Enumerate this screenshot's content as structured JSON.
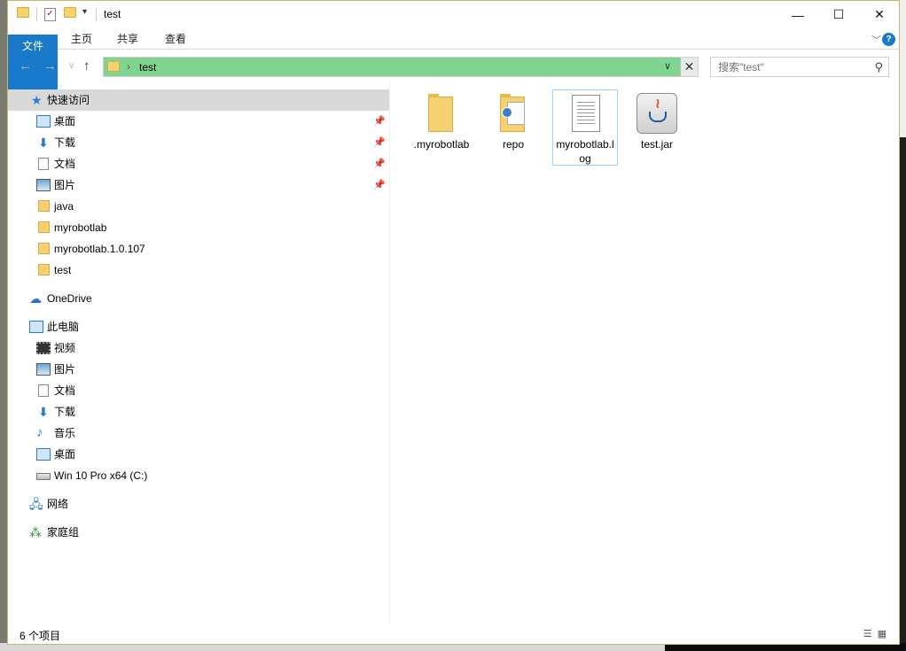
{
  "window": {
    "title": "test",
    "controls": {
      "minimize": "—",
      "maximize": "☐",
      "close": "✕"
    }
  },
  "ribbon": {
    "tabs": [
      {
        "label": "文件"
      },
      {
        "label": "主页"
      },
      {
        "label": "共享"
      },
      {
        "label": "查看"
      }
    ],
    "expand": "﹀",
    "help": "?"
  },
  "nav": {
    "back": "←",
    "forward": "→",
    "recent": "∨",
    "up": "↑",
    "crumb_sep": "›",
    "crumb": "test",
    "dropdown": "∨",
    "clear": "✕"
  },
  "search": {
    "placeholder": "搜索\"test\"",
    "icon": "search-icon"
  },
  "sidebar": {
    "quick_access": "快速访问",
    "items": [
      {
        "label": "桌面"
      },
      {
        "label": "下载"
      },
      {
        "label": "文档"
      },
      {
        "label": "图片"
      },
      {
        "label": "java"
      },
      {
        "label": "myrobotlab"
      },
      {
        "label": "myrobotlab.1.0.107"
      },
      {
        "label": "test"
      }
    ],
    "onedrive": "OneDrive",
    "this_pc": "此电脑",
    "pc_items": [
      {
        "label": "视频"
      },
      {
        "label": "图片"
      },
      {
        "label": "文档"
      },
      {
        "label": "下载"
      },
      {
        "label": "音乐"
      },
      {
        "label": "桌面"
      },
      {
        "label": "Win 10 Pro x64 (C:)"
      }
    ],
    "network": "网络",
    "homegroup": "家庭组"
  },
  "files": [
    {
      "name": ".myrobotlab",
      "type": "folder"
    },
    {
      "name": "repo",
      "type": "folder"
    },
    {
      "name": "myrobotlab.log",
      "type": "document",
      "selected": true
    },
    {
      "name": "test.jar",
      "type": "jar"
    }
  ],
  "status": {
    "count": "6 个项目"
  },
  "colors": {
    "accent": "#1979ca",
    "address_highlight": "#7fd58f",
    "selection": "#d9d9d9"
  }
}
